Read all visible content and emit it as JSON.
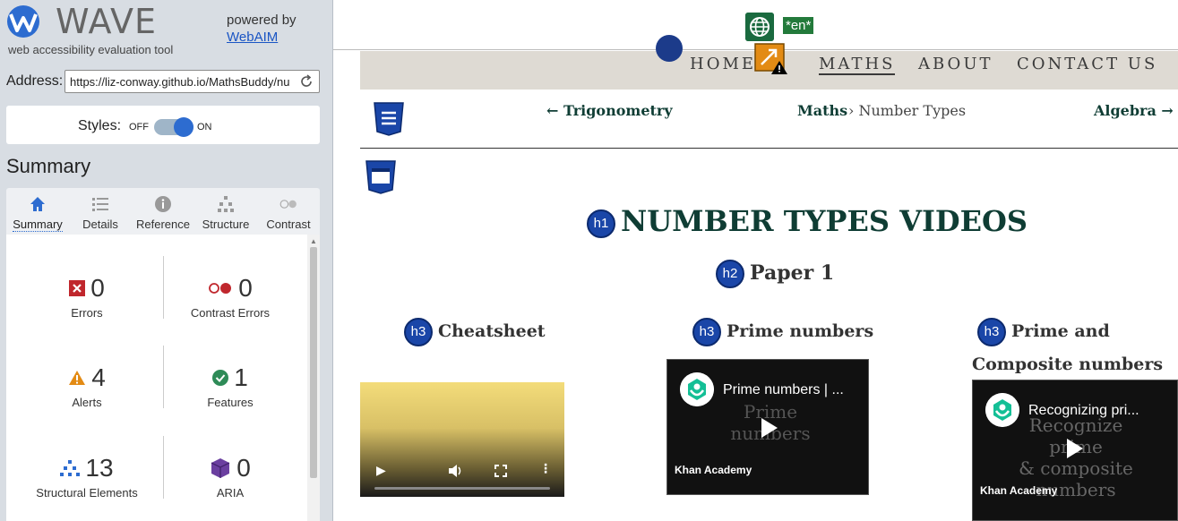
{
  "wave": {
    "title": "WAVE",
    "subtitle": "web accessibility evaluation tool",
    "powered_by": "powered by",
    "webaim": "WebAIM",
    "address_label": "Address:",
    "address_value": "https://liz-conway.github.io/MathsBuddy/nu",
    "styles_label": "Styles:",
    "styles_off": "OFF",
    "styles_on": "ON",
    "styles_enabled": true,
    "summary_heading": "Summary",
    "tabs": [
      {
        "label": "Summary",
        "icon": "home-icon",
        "active": true
      },
      {
        "label": "Details",
        "icon": "list-icon",
        "active": false
      },
      {
        "label": "Reference",
        "icon": "info-icon",
        "active": false
      },
      {
        "label": "Structure",
        "icon": "structure-icon",
        "active": false
      },
      {
        "label": "Contrast",
        "icon": "contrast-icon",
        "active": false
      }
    ],
    "stats": {
      "errors": {
        "count": "0",
        "label": "Errors",
        "color": "#c0272d"
      },
      "contrast_errors": {
        "count": "0",
        "label": "Contrast Errors",
        "color": "#c0272d"
      },
      "alerts": {
        "count": "4",
        "label": "Alerts",
        "color": "#e38b14"
      },
      "features": {
        "count": "1",
        "label": "Features",
        "color": "#2e8b57"
      },
      "structural": {
        "count": "13",
        "label": "Structural Elements",
        "color": "#2d6cd0"
      },
      "aria": {
        "count": "0",
        "label": "ARIA",
        "color": "#6b3fa0"
      }
    }
  },
  "site": {
    "lang_badge": "*en*",
    "nav": [
      {
        "label": "HOME",
        "active": false
      },
      {
        "label": "MATHS",
        "active": true
      },
      {
        "label": "ABOUT",
        "active": false
      },
      {
        "label": "CONTACT US",
        "active": false
      }
    ],
    "breadcrumb": {
      "prev": "← Trigonometry",
      "section": "Maths",
      "current": "› Number Types",
      "next": "Algebra →"
    },
    "h1_badge": "h1",
    "h1": "NUMBER TYPES VIDEOS",
    "h2_badge": "h2",
    "h2": "Paper 1",
    "h3_badge": "h3",
    "videos": [
      {
        "heading": "Cheatsheet"
      },
      {
        "heading": "Prime numbers",
        "title": "Prime numbers | ...",
        "bg_line1": "Prime",
        "bg_line2": "numbers",
        "brand": "Khan Academy"
      },
      {
        "heading_line1": "Prime and",
        "heading_line2": "Composite numbers",
        "title": "Recognizing pri...",
        "bg_line1": "Recognize prime",
        "bg_line2": "& composite",
        "bg_line3": "numbers",
        "brand": "Khan Academy"
      }
    ]
  },
  "colors": {
    "accent": "#2d6cd0",
    "heading": "#0f3d34",
    "nav_band": "#dedad3"
  }
}
